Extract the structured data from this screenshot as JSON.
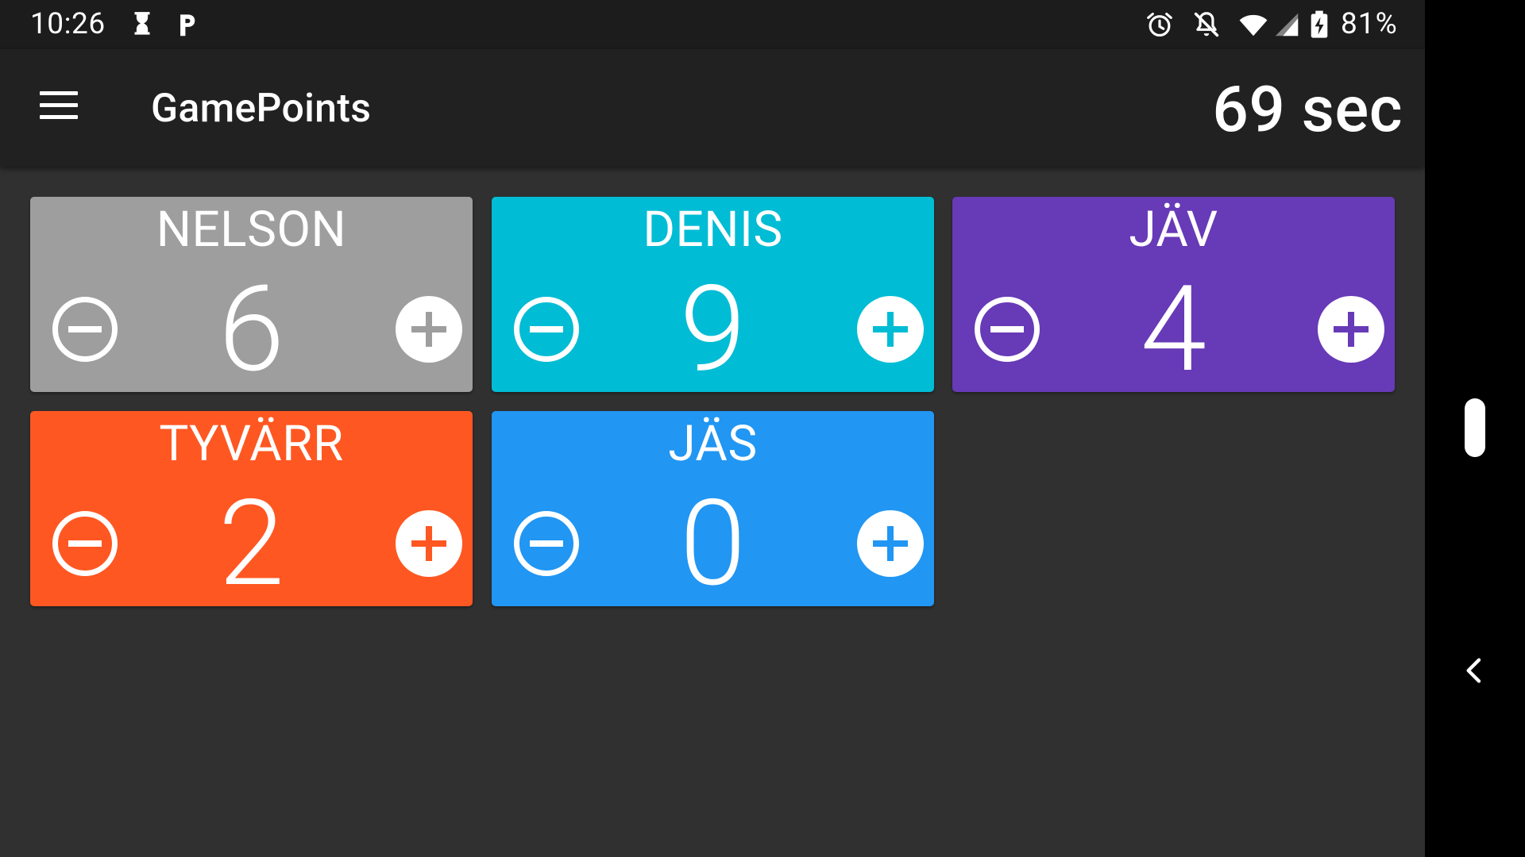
{
  "status_bar": {
    "time": "10:26",
    "battery": "81%",
    "left_icons": [
      "hourglass-icon",
      "parking-icon"
    ],
    "right_icons": [
      "alarm-icon",
      "notifications-off-icon",
      "wifi-icon",
      "cellular-signal-icon",
      "battery-charging-icon"
    ]
  },
  "app_bar": {
    "title": "GamePoints",
    "timer": "69 sec",
    "menu_icon": "hamburger-menu-icon"
  },
  "players": [
    {
      "name": "NELSON",
      "score": "6",
      "color": "#9e9e9e"
    },
    {
      "name": "DENIS",
      "score": "9",
      "color": "#00bcd4"
    },
    {
      "name": "JÄV",
      "score": "4",
      "color": "#673ab7"
    },
    {
      "name": "TYVÄRR",
      "score": "2",
      "color": "#ff5722"
    },
    {
      "name": "JÄS",
      "score": "0",
      "color": "#2196f3"
    }
  ],
  "colors": {
    "background": "#303030",
    "app_bar": "#212121",
    "status_bar": "#1c1c1c",
    "nav_bar": "#000000"
  },
  "nav_bar": {
    "icons": [
      "home-pill-icon",
      "back-chevron-icon"
    ]
  }
}
